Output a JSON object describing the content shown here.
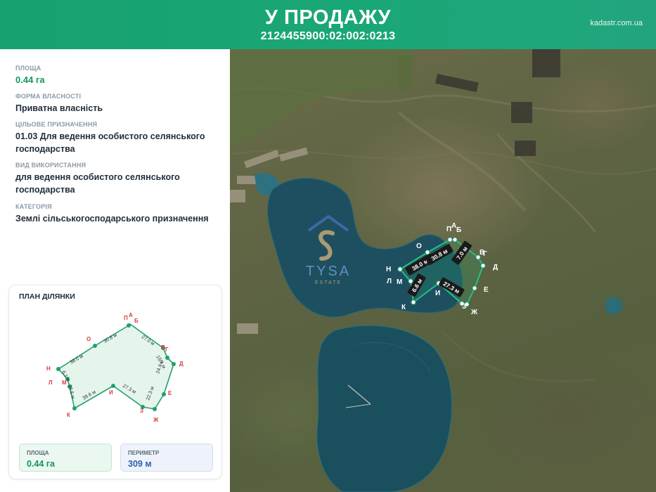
{
  "header": {
    "title": "У ПРОДАЖУ",
    "cadastral": "2124455900:02:002:0213",
    "site": "kadastr.com.ua"
  },
  "info": {
    "area_label": "ПЛОЩА",
    "area_value": "0.44 га",
    "ownership_label": "ФОРМА ВЛАСНОСТІ",
    "ownership_value": "Приватна власність",
    "purpose_label": "ЦІЛЬОВЕ ПРИЗНАЧЕННЯ",
    "purpose_value": "01.03 Для ведення особистого селянського господарства",
    "usage_label": "ВИД ВИКОРИСТАННЯ",
    "usage_value": "для ведення особистого селянського господарства",
    "category_label": "КАТЕГОРІЯ",
    "category_value": "Землі сільськогосподарського призначення"
  },
  "plan": {
    "title": "ПЛАН ДІЛЯНКИ",
    "vertices": [
      "Н",
      "О",
      "П",
      "А",
      "Б",
      "В",
      "Г",
      "Д",
      "Е",
      "Ж",
      "З",
      "И",
      "К",
      "Л",
      "М"
    ],
    "segments": [
      "38.0 м",
      "30.8 м",
      "27.0 м",
      "15.4 м",
      "24.4 м",
      "22.3 м",
      "27.3 м",
      "39.6 м",
      "28.6 м",
      "6.1 м"
    ],
    "area_label": "ПЛОЩА",
    "area_value": "0.44 га",
    "perimeter_label": "ПЕРИМЕТР",
    "perimeter_value": "309 м"
  },
  "map": {
    "segments": [
      "38.0 м",
      "30.8 м",
      "7.0 м",
      "27.3 м",
      "6.6 м"
    ],
    "vertices": [
      "П",
      "А",
      "Б",
      "В",
      "Г",
      "О",
      "Н",
      "Л",
      "М",
      "Д",
      "И",
      "Е",
      "К",
      "З",
      "Ж"
    ],
    "watermark_name": "TYSA",
    "watermark_sub": "ESTATE"
  },
  "colors": {
    "header": "#1aa776",
    "parcel": "#1f9b6a",
    "vertex": "#e03a3a"
  }
}
